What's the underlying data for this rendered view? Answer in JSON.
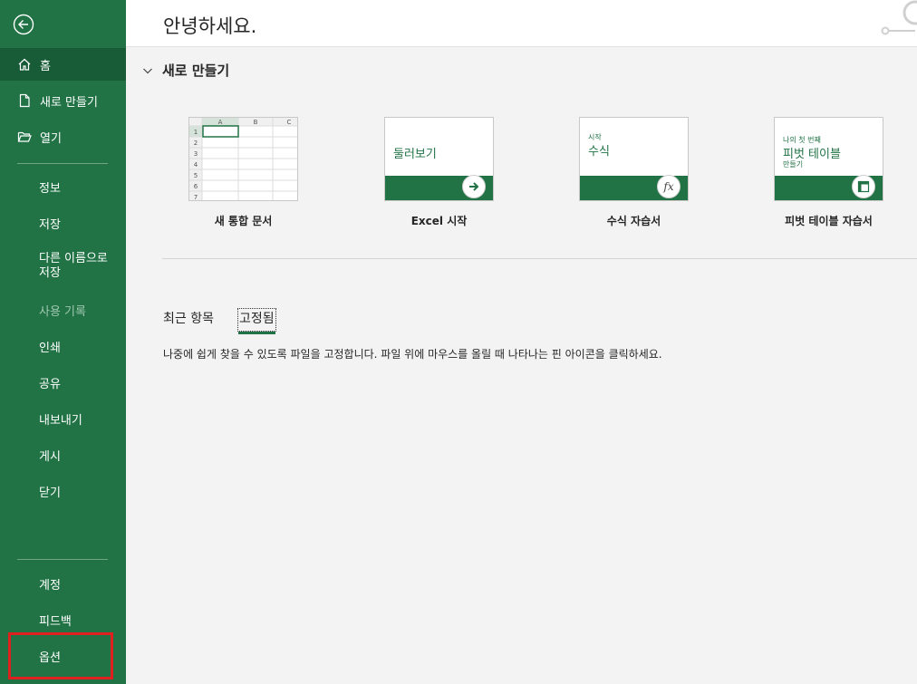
{
  "sidebar": {
    "items": [
      {
        "id": "home",
        "label": "홈",
        "icon": "home-icon",
        "active": true
      },
      {
        "id": "new",
        "label": "새로 만들기",
        "icon": "new-document-icon"
      },
      {
        "id": "open",
        "label": "열기",
        "icon": "open-folder-icon"
      },
      {
        "id": "info",
        "label": "정보"
      },
      {
        "id": "save",
        "label": "저장"
      },
      {
        "id": "save-as",
        "label": "다른 이름으로 저장",
        "line1": "다른 이름으로",
        "line2": "저장"
      },
      {
        "id": "history",
        "label": "사용 기록",
        "disabled": true
      },
      {
        "id": "print",
        "label": "인쇄"
      },
      {
        "id": "share",
        "label": "공유"
      },
      {
        "id": "export",
        "label": "내보내기"
      },
      {
        "id": "publish",
        "label": "게시"
      },
      {
        "id": "close",
        "label": "닫기"
      },
      {
        "id": "account",
        "label": "계정"
      },
      {
        "id": "feedback",
        "label": "피드백"
      },
      {
        "id": "options",
        "label": "옵션"
      }
    ]
  },
  "header": {
    "greeting": "안녕하세요."
  },
  "new_section": {
    "title": "새로 만들기",
    "templates": [
      {
        "label": "새 통합 문서",
        "columns": [
          "A",
          "B",
          "C"
        ],
        "rows": [
          "1",
          "2",
          "3",
          "4",
          "5",
          "6",
          "7"
        ]
      },
      {
        "label": "Excel 시작",
        "thumb_title": "둘러보기"
      },
      {
        "label": "수식 자습서",
        "thumb_small": "시작",
        "thumb_title": "수식",
        "badge": "fx"
      },
      {
        "label": "피벗 테이블 자습서",
        "thumb_small": "나의 첫 번째",
        "thumb_title": "피벗 테이블",
        "thumb_small2": "만들기"
      }
    ]
  },
  "files": {
    "tabs": [
      {
        "label": "최근 항목",
        "selected": false
      },
      {
        "label": "고정됨",
        "selected": true
      }
    ],
    "hint": "나중에 쉽게 찾을 수 있도록 파일을 고정합니다. 파일 위에 마우스를 올릴 때 나타나는 핀 아이콘을 클릭하세요."
  },
  "colors": {
    "accent": "#217346",
    "accent_dark": "#185c37",
    "highlight": "#e0201f"
  }
}
